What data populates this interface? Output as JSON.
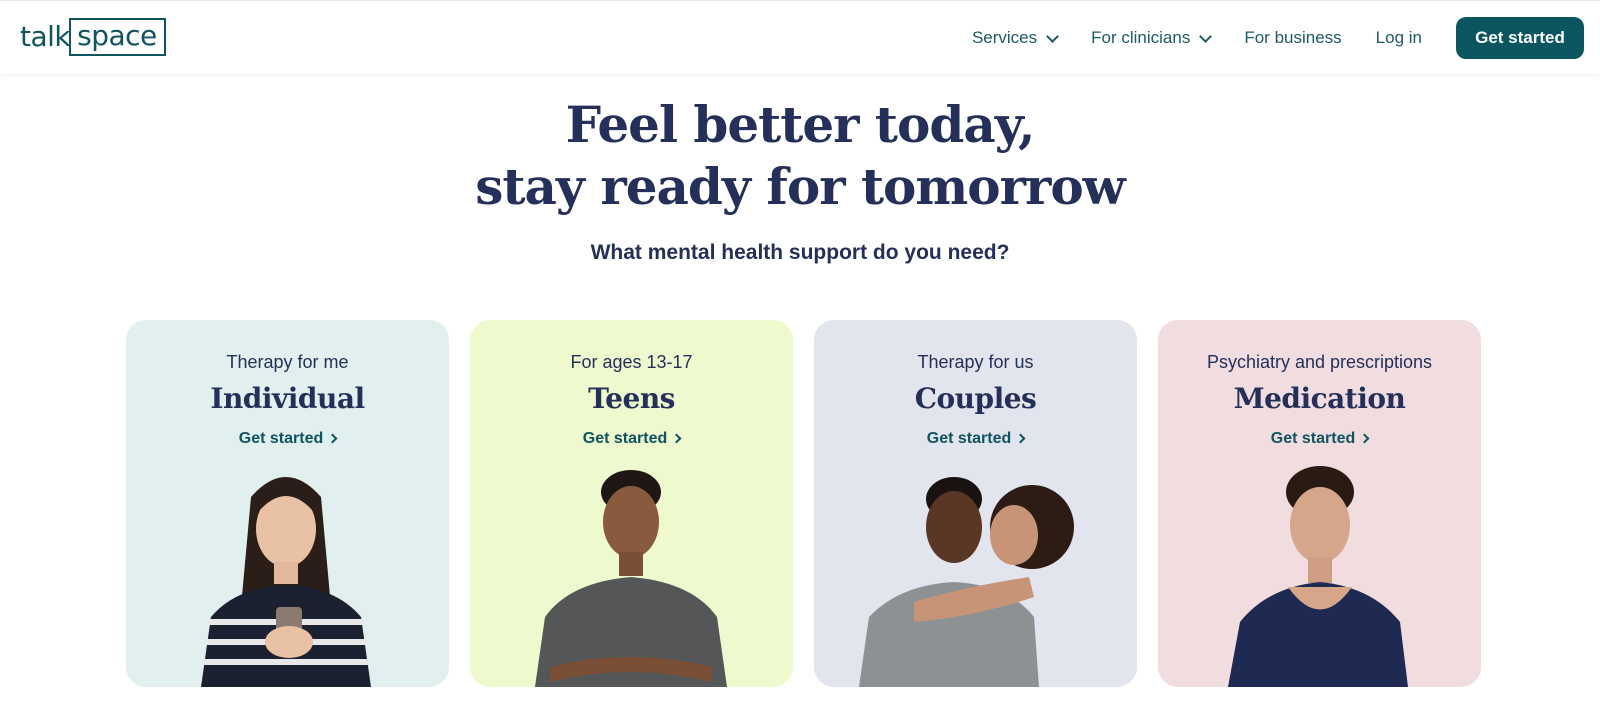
{
  "brand": {
    "logo_left": "talk",
    "logo_right": "space",
    "accent": "#0b5561",
    "text_color": "#24305a"
  },
  "nav": {
    "services": "Services",
    "clinicians": "For clinicians",
    "business": "For business",
    "login": "Log in",
    "cta": "Get started"
  },
  "hero": {
    "line1": "Feel better today,",
    "line2": "stay ready for tomorrow",
    "subtitle": "What mental health support do you need?"
  },
  "cards": [
    {
      "eyebrow": "Therapy for me",
      "title": "Individual",
      "cta": "Get started",
      "bg": "#e1efee"
    },
    {
      "eyebrow": "For ages 13-17",
      "title": "Teens",
      "cta": "Get started",
      "bg": "#eef9cd"
    },
    {
      "eyebrow": "Therapy for us",
      "title": "Couples",
      "cta": "Get started",
      "bg": "#e2e4ee"
    },
    {
      "eyebrow": "Psychiatry and prescriptions",
      "title": "Medication",
      "cta": "Get started",
      "bg": "#f1dcdf"
    }
  ]
}
